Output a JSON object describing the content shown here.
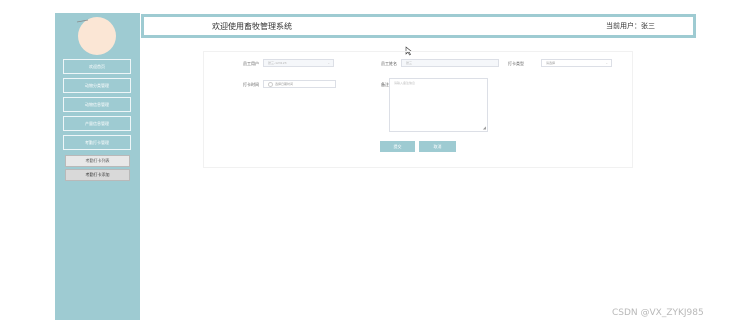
{
  "sidebar": {
    "menu": [
      {
        "label": "欢迎首页"
      },
      {
        "label": "动物分类管理"
      },
      {
        "label": "动物信息管理"
      },
      {
        "label": "产量信息管理"
      },
      {
        "label": "考勤打卡管理"
      }
    ],
    "submenu": [
      {
        "label": "考勤打卡列表"
      },
      {
        "label": "考勤打卡添加"
      }
    ]
  },
  "header": {
    "title": "欢迎使用畜牧管理系统",
    "current_user": "当前用户：张三"
  },
  "form": {
    "employee_user_label": "员工用户",
    "employee_user_value": "张三-123123",
    "employee_name_label": "员工姓名",
    "employee_name_value": "张三",
    "punch_type_label": "打卡类型",
    "punch_type_placeholder": "请选择",
    "punch_time_label": "打卡时间",
    "punch_time_placeholder": "选择日期时间",
    "remark_label": "备注信息",
    "remark_placeholder": "请输入备注信息",
    "submit_label": "提交",
    "cancel_label": "取消"
  },
  "watermark": "CSDN @VX_ZYKJ985",
  "colors": {
    "accent": "#9ecbd2",
    "avatar": "#fbe6d5"
  }
}
